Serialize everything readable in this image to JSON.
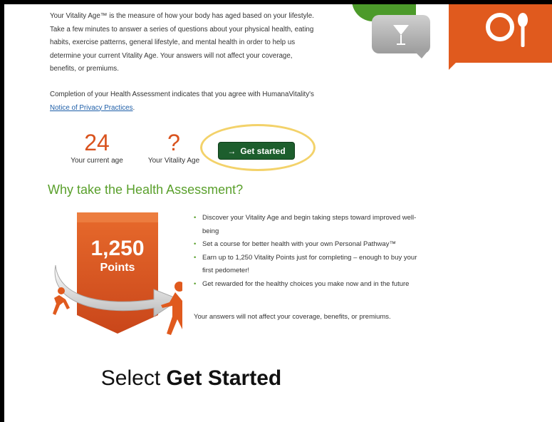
{
  "intro_text": "Your Vitality Age™ is the measure of how your body has aged based on your lifestyle. Take a few minutes to answer a series of questions about your physical health, eating habits, exercise patterns, general lifestyle, and mental health in order to help us determine your current Vitality Age. Your answers will not affect your coverage, benefits, or premiums.",
  "consent": {
    "prefix": "Completion of your Health Assessment indicates that you agree with HumanaVitality's ",
    "link": "Notice of Privacy Practices",
    "suffix": "."
  },
  "current_age": {
    "value": "24",
    "label": "Your current age"
  },
  "vitality_age": {
    "value": "?",
    "label": "Your Vitality Age"
  },
  "cta": {
    "arrow": "→",
    "label": "Get started",
    "highlight_color": "#f3d26a"
  },
  "why": {
    "title": "Why take the Health Assessment?",
    "bullets": [
      "Discover your Vitality Age and begin taking steps toward improved well-being",
      "Set a course for better health with your own Personal Pathway™",
      "Earn up to 1,250 Vitality Points just for completing – enough to buy your first pedometer!",
      "Get rewarded for the healthy choices you make now and in the future"
    ],
    "answers_note": "Your answers will not affect your coverage, benefits, or premiums."
  },
  "badge": {
    "points": "1,250",
    "label": "Points"
  },
  "caption": {
    "prefix": "Select ",
    "bold": "Get Started"
  },
  "colors": {
    "orange": "#e05a1e",
    "green": "#5aa02c",
    "button": "#1d5e2d"
  },
  "icons": [
    "cocktail-glass-icon",
    "plate-fork-knife-icon",
    "bullet-dot-icon",
    "arrow-right-icon",
    "runner-icon"
  ]
}
